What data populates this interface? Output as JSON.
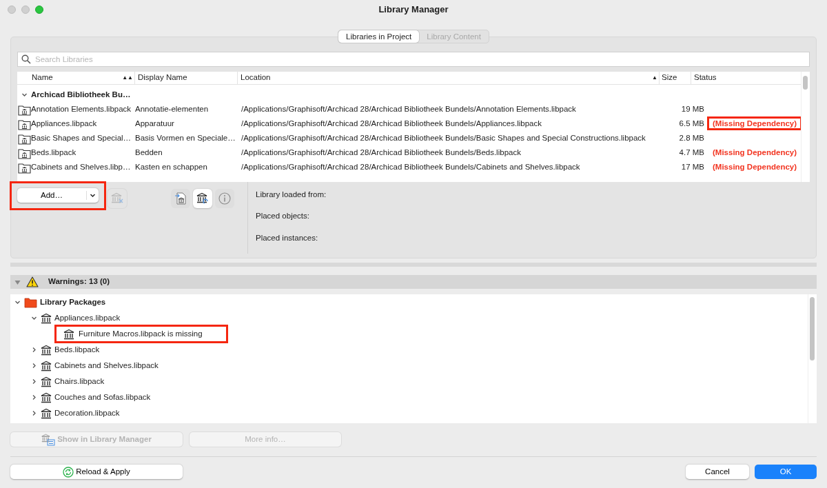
{
  "window": {
    "title": "Library Manager"
  },
  "tabs": [
    {
      "label": "Libraries in Project",
      "selected": true
    },
    {
      "label": "Library Content",
      "selected": false
    }
  ],
  "search": {
    "placeholder": "Search Libraries"
  },
  "table": {
    "columns": [
      {
        "label": "Name",
        "sort_indicator": "▲▲"
      },
      {
        "label": "Display Name"
      },
      {
        "label": "Location",
        "sort_indicator": "▲"
      },
      {
        "label": "Size"
      },
      {
        "label": "Status"
      }
    ],
    "group": {
      "label": "Archicad Bibliotheek Bu…",
      "expanded": true
    },
    "rows": [
      {
        "name": "Annotation Elements.libpack",
        "display_name": "Annotatie-elementen",
        "location": "/Applications/Graphisoft/Archicad 28/Archicad Bibliotheek Bundels/Annotation Elements.libpack",
        "size": "19 MB"
      },
      {
        "name": "Appliances.libpack",
        "display_name": "Apparatuur",
        "location": "/Applications/Graphisoft/Archicad 28/Archicad Bibliotheek Bundels/Appliances.libpack",
        "size": "6.5 MB",
        "status": "(Missing Dependency)",
        "highlighted": true
      },
      {
        "name": "Basic Shapes and Special…",
        "display_name": "Basis Vormen en Speciale…",
        "location": "/Applications/Graphisoft/Archicad 28/Archicad Bibliotheek Bundels/Basic Shapes and Special Constructions.libpack",
        "size": "2.8 MB"
      },
      {
        "name": "Beds.libpack",
        "display_name": "Bedden",
        "location": "/Applications/Graphisoft/Archicad 28/Archicad Bibliotheek Bundels/Beds.libpack",
        "size": "4.7 MB",
        "status": "(Missing Dependency)"
      },
      {
        "name": "Cabinets and Shelves.libp…",
        "display_name": "Kasten en schappen",
        "location": "/Applications/Graphisoft/Archicad 28/Archicad Bibliotheek Bundels/Cabinets and Shelves.libpack",
        "size": "17 MB",
        "status": "(Missing Dependency)"
      }
    ]
  },
  "add_button": {
    "label": "Add…",
    "highlighted": true
  },
  "icon_buttons": [
    {
      "kind": "remove",
      "disabled": true
    },
    {
      "kind": "import",
      "disabled": false
    },
    {
      "kind": "refresh",
      "disabled": false
    },
    {
      "kind": "info",
      "disabled": false
    }
  ],
  "details": [
    "Library loaded from:",
    "Placed objects:",
    "Placed instances:"
  ],
  "warnings": {
    "label": "Warnings: 13 (0)",
    "expanded": true
  },
  "tree": [
    {
      "label": "Library Packages",
      "kind": "folder",
      "expanded": true,
      "children": [
        {
          "label": "Appliances.libpack",
          "kind": "package",
          "expanded": true,
          "children": [
            {
              "label": "Furniture Macros.libpack is missing",
              "kind": "package",
              "highlighted": true
            }
          ]
        },
        {
          "label": "Beds.libpack",
          "kind": "package",
          "expanded": false
        },
        {
          "label": "Cabinets and Shelves.libpack",
          "kind": "package",
          "expanded": false
        },
        {
          "label": "Chairs.libpack",
          "kind": "package",
          "expanded": false
        },
        {
          "label": "Couches and Sofas.libpack",
          "kind": "package",
          "expanded": false
        },
        {
          "label": "Decoration.libpack",
          "kind": "package",
          "expanded": false
        }
      ]
    }
  ],
  "warning_buttons": [
    {
      "label": "Show in Library Manager",
      "kind": "show",
      "disabled": true
    },
    {
      "label": "More info…",
      "kind": "plain",
      "disabled": true
    }
  ],
  "footer": {
    "reload": "Reload & Apply",
    "cancel": "Cancel",
    "ok": "OK"
  }
}
